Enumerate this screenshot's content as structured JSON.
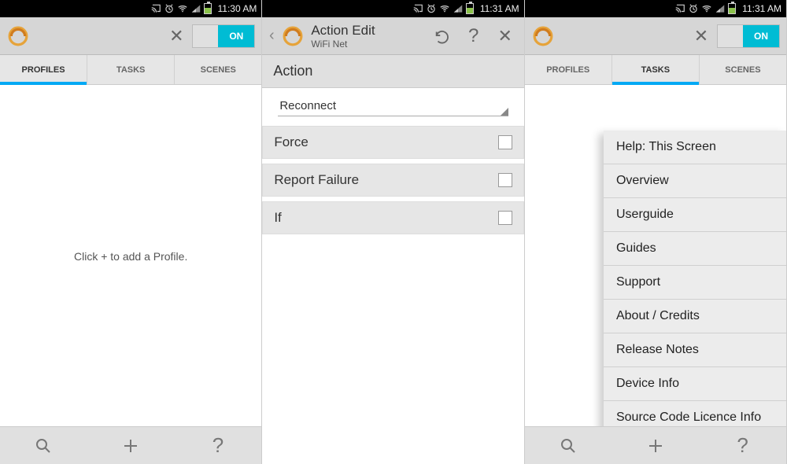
{
  "statusbar": {
    "pane1_time": "11:30 AM",
    "pane2_time": "11:31 AM",
    "pane3_time": "11:31 AM",
    "icons": [
      "cast-icon",
      "alarm-icon",
      "wifi-icon",
      "signal-icon",
      "battery-icon"
    ]
  },
  "appbar": {
    "close_glyph": "✕",
    "toggle_label": "ON",
    "action_edit_title": "Action Edit",
    "action_edit_subtitle": "WiFi Net",
    "help_glyph": "?",
    "undo_icon": "undo-icon"
  },
  "tabs": {
    "items": [
      "PROFILES",
      "TASKS",
      "SCENES"
    ],
    "pane1_active": 0,
    "pane3_active": 1
  },
  "pane1": {
    "hint": "Click + to add a Profile."
  },
  "pane2": {
    "section_label": "Action",
    "select_value": "Reconnect",
    "rows": [
      {
        "label": "Force",
        "checked": false
      },
      {
        "label": "Report Failure",
        "checked": false
      },
      {
        "label": "If",
        "checked": false
      }
    ]
  },
  "pane3": {
    "menu": [
      "Help: This Screen",
      "Overview",
      "Userguide",
      "Guides",
      "Support",
      "About / Credits",
      "Release Notes",
      "Device Info",
      "Source Code Licence Info"
    ]
  }
}
